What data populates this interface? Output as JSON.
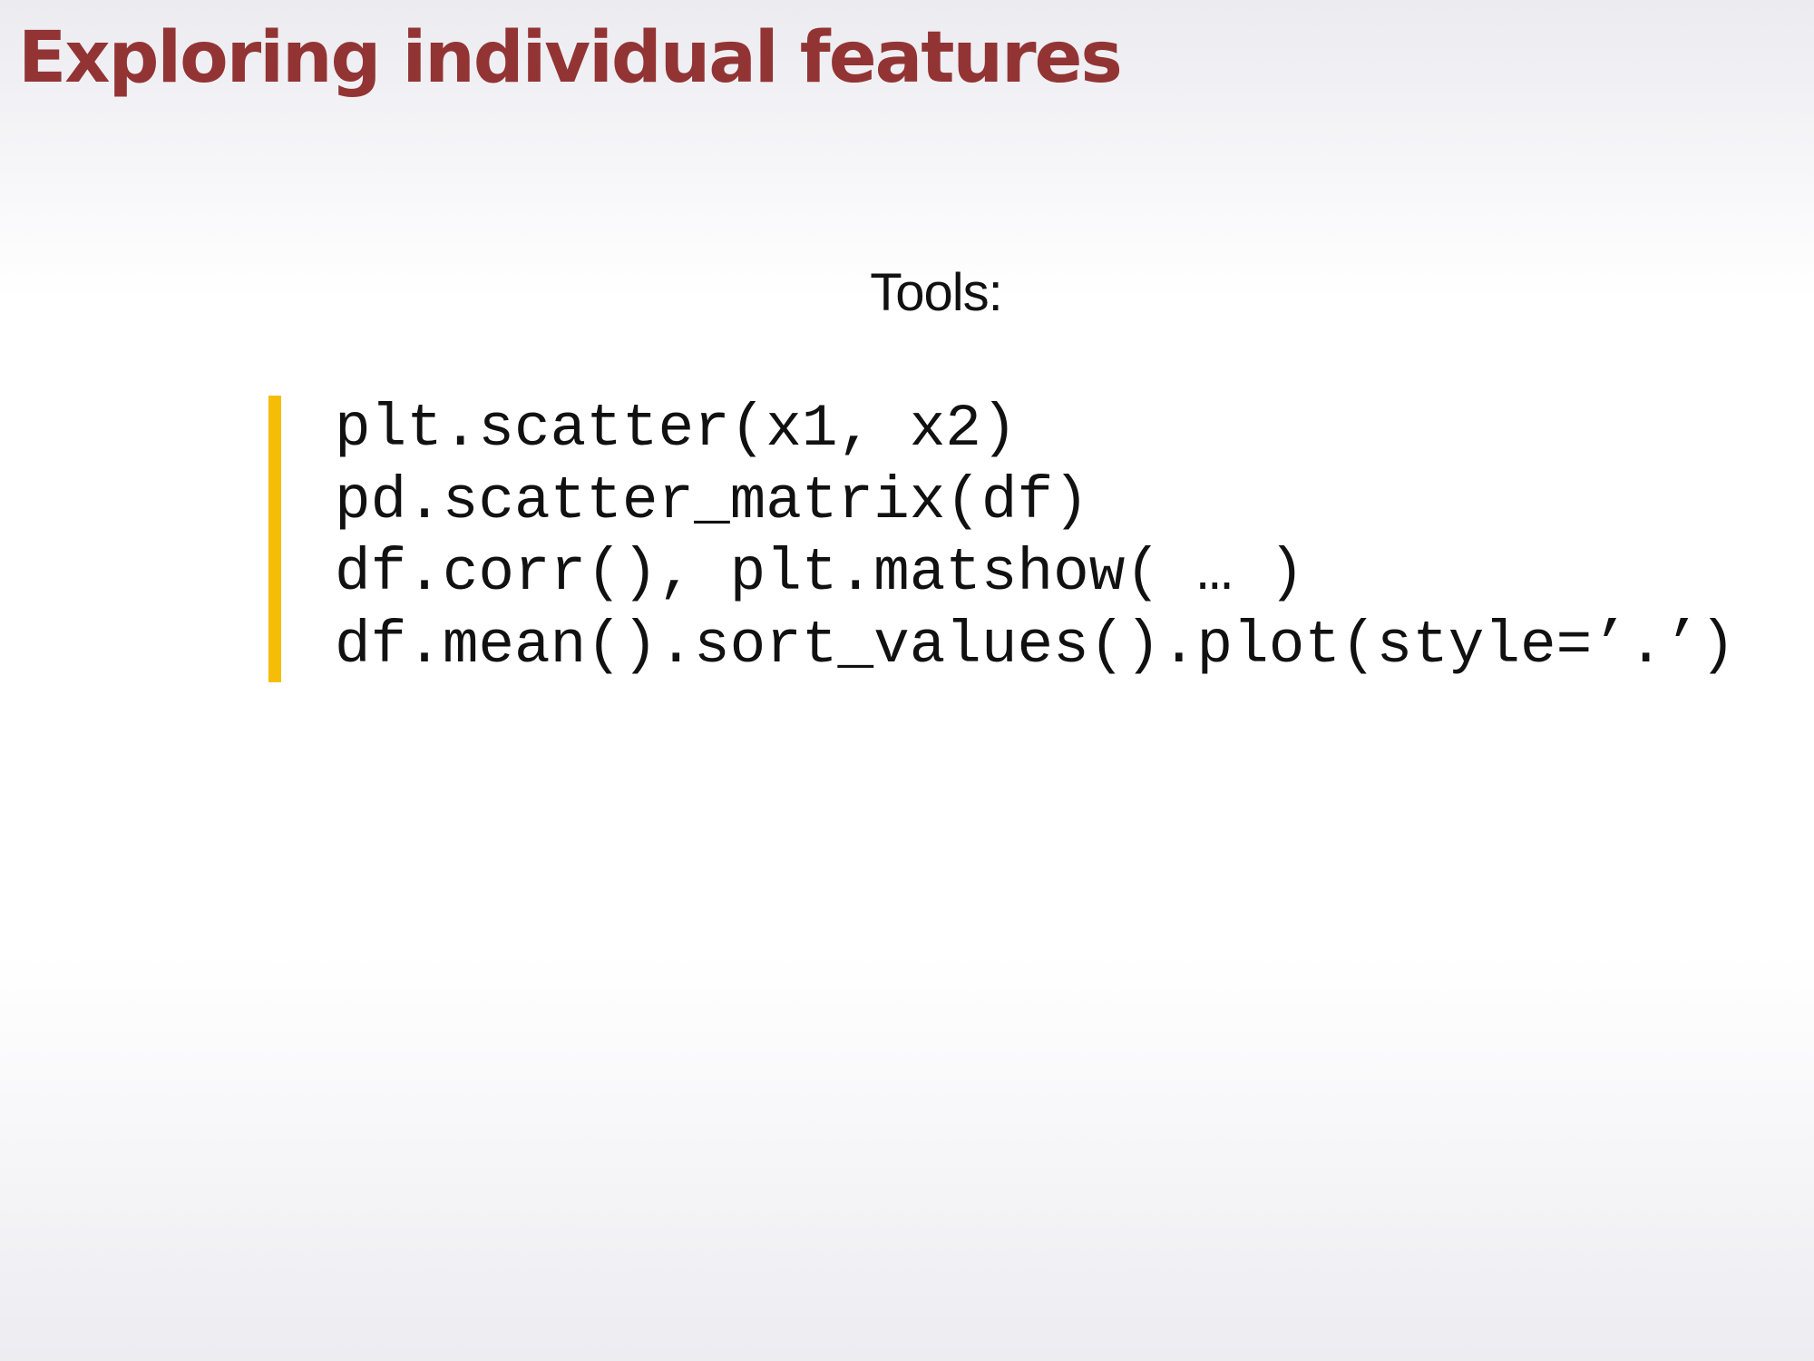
{
  "slide": {
    "title": "Exploring individual features",
    "tools_heading": "Tools:",
    "code_lines": [
      "plt.scatter(x1, x2)",
      "pd.scatter_matrix(df)",
      "df.corr(), plt.matshow( … )",
      "df.mean().sort_values().plot(style=’.’)"
    ]
  },
  "colors": {
    "title": "#933434",
    "accent_bar": "#f5bd06",
    "text": "#111111"
  }
}
